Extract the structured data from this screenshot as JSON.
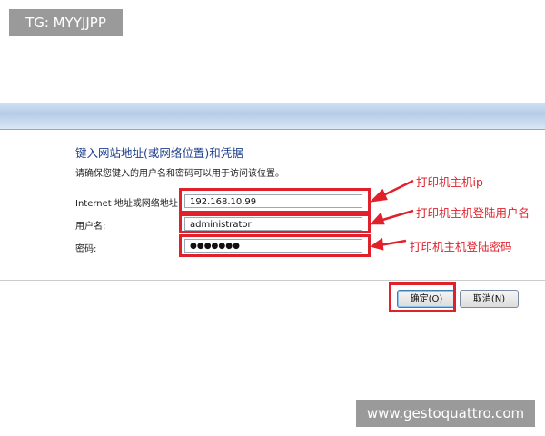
{
  "watermark_top": "TG: MYYJJPP",
  "watermark_bottom": "www.gestoquattro.com",
  "dialog": {
    "heading": "键入网站地址(或网络位置)和凭据",
    "description": "请确保您键入的用户名和密码可以用于访问该位置。",
    "fields": [
      {
        "label": "Internet 地址或网络地址:",
        "value": "192.168.10.99"
      },
      {
        "label": "用户名:",
        "value": "administrator"
      },
      {
        "label": "密码:",
        "value": "●●●●●●●"
      }
    ],
    "ok_label": "确定(O)",
    "cancel_label": "取消(N)"
  },
  "annotations": {
    "ip": "打印机主机ip",
    "username": "打印机主机登陆用户名",
    "password": "打印机主机登陆密码"
  },
  "colors": {
    "annotation_red": "#e0212b",
    "heading_blue": "#1e3f8c"
  }
}
